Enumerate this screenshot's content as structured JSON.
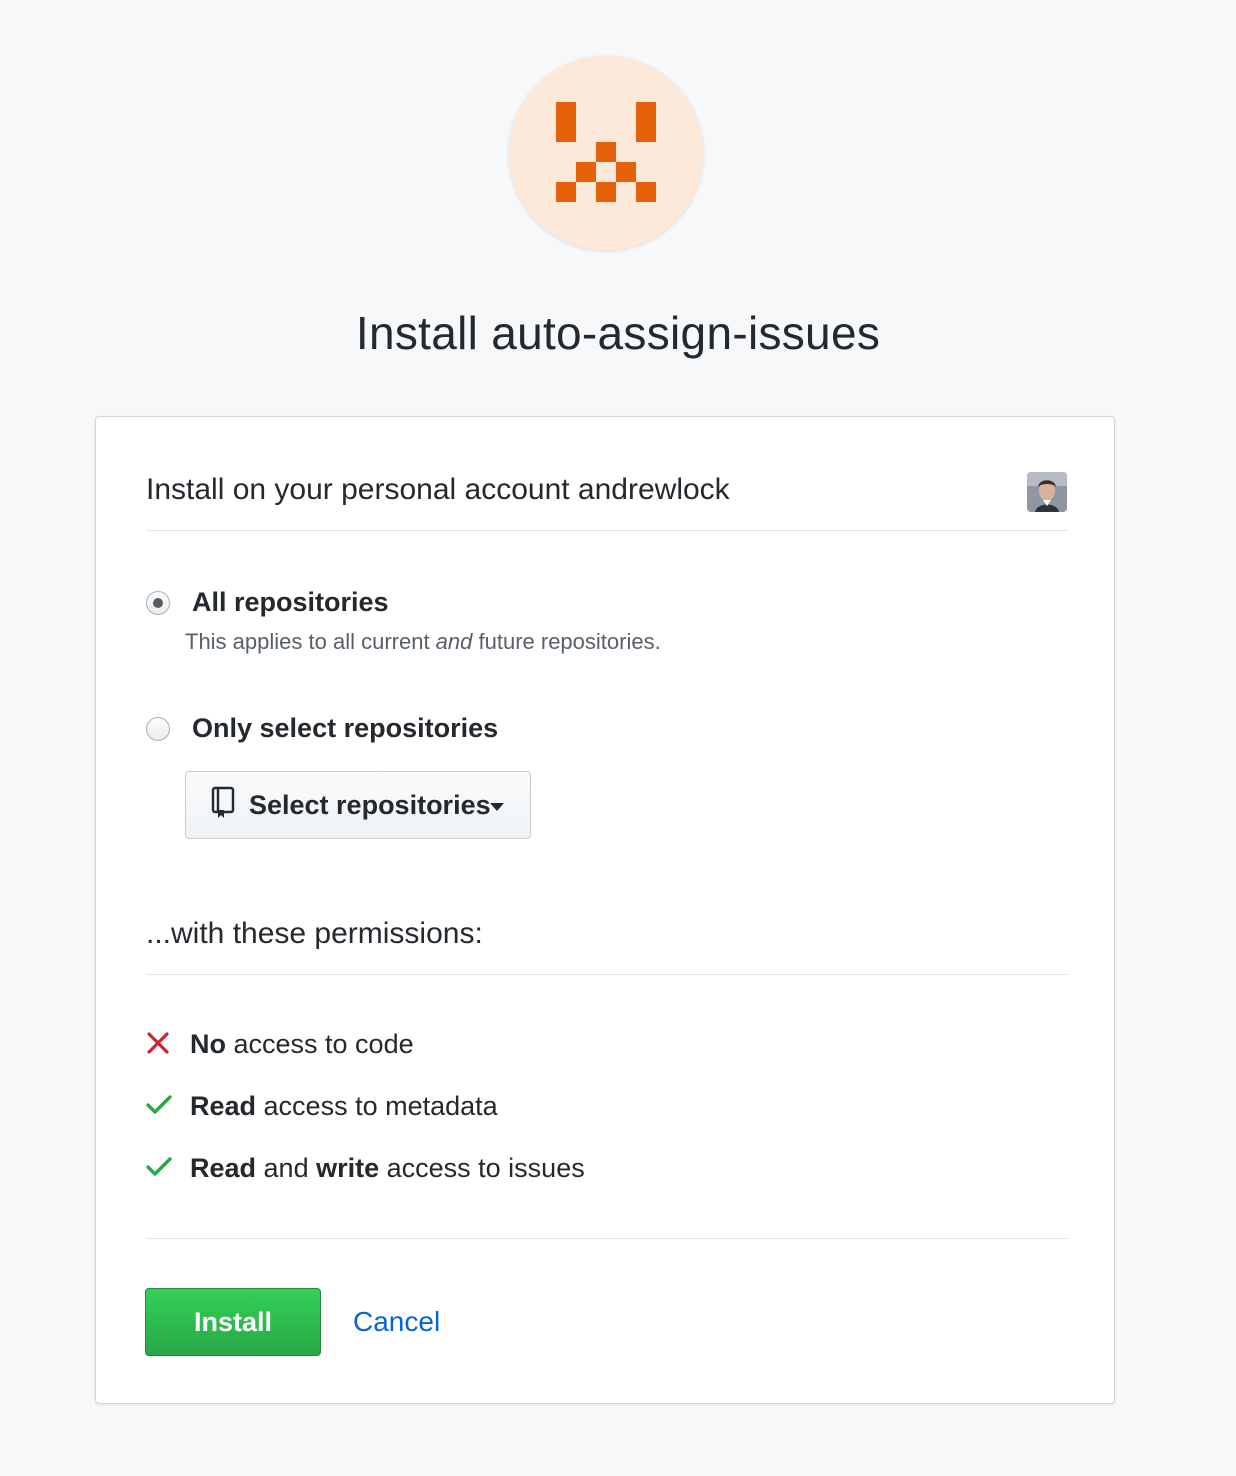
{
  "app": {
    "title": "Install auto-assign-issues",
    "logo_color": "#e36209",
    "logo_bg": "#fde9d9"
  },
  "account": {
    "heading": "Install on your personal account andrewlock"
  },
  "repo_options": {
    "all": {
      "label": "All repositories",
      "note_before": "This applies to all current ",
      "note_emphasis": "and",
      "note_after": " future repositories.",
      "checked": true
    },
    "select": {
      "label": "Only select repositories",
      "checked": false,
      "button_label": "Select repositories"
    }
  },
  "permissions": {
    "heading": "...with these permissions:",
    "items": [
      {
        "status": "denied",
        "icon": "x-icon",
        "bold1": "No",
        "text1": " access to code",
        "bold2": "",
        "text2": ""
      },
      {
        "status": "granted",
        "icon": "check-icon",
        "bold1": "Read",
        "text1": " access to metadata",
        "bold2": "",
        "text2": ""
      },
      {
        "status": "granted",
        "icon": "check-icon",
        "bold1": "Read",
        "text1": " and ",
        "bold2": "write",
        "text2": " access to issues"
      }
    ]
  },
  "actions": {
    "install_label": "Install",
    "cancel_label": "Cancel"
  },
  "colors": {
    "install_green": "#28a745",
    "link_blue": "#0366d6",
    "deny_red": "#cb2431",
    "grant_green": "#28a745"
  }
}
